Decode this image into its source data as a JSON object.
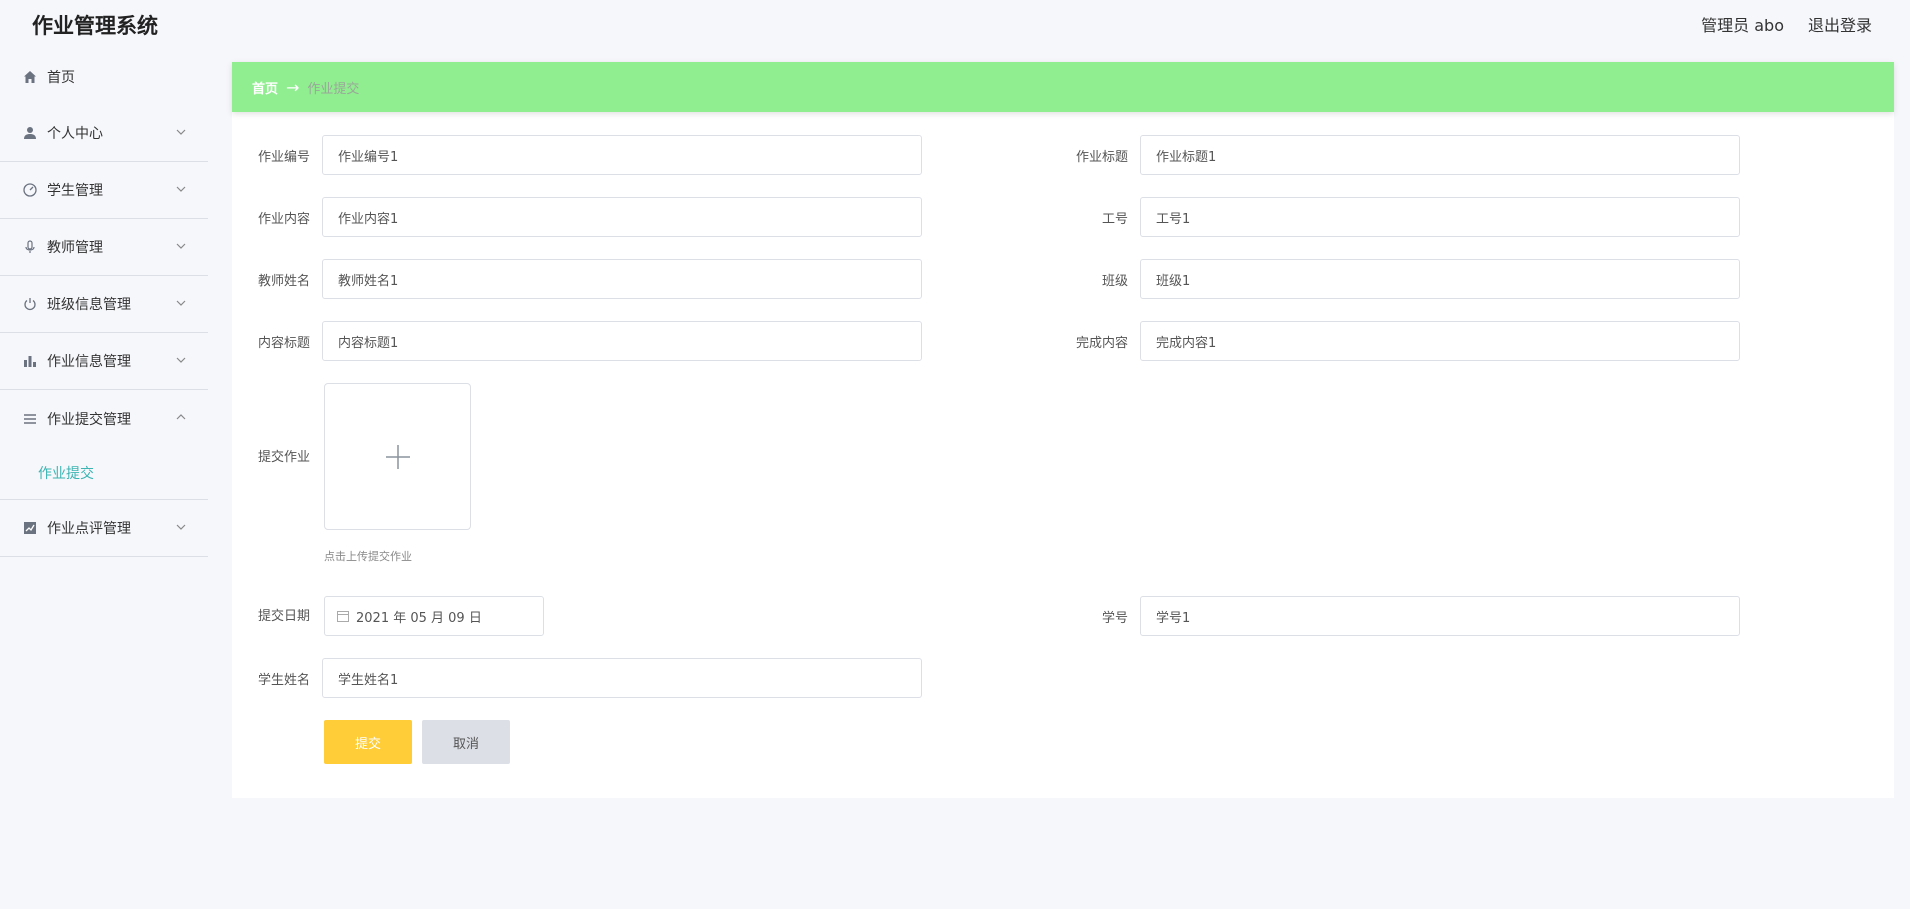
{
  "app": {
    "title": "作业管理系统"
  },
  "header": {
    "user": "管理员 abo",
    "logout": "退出登录"
  },
  "sidebar": {
    "items": [
      {
        "label": "首页",
        "icon": "home-icon"
      },
      {
        "label": "个人中心",
        "icon": "user-icon"
      },
      {
        "label": "学生管理",
        "icon": "dashboard-icon"
      },
      {
        "label": "教师管理",
        "icon": "microphone-icon"
      },
      {
        "label": "班级信息管理",
        "icon": "power-icon"
      },
      {
        "label": "作业信息管理",
        "icon": "bar-chart-icon"
      },
      {
        "label": "作业提交管理",
        "icon": "list-icon",
        "expanded": true,
        "children": [
          "作业提交"
        ]
      },
      {
        "label": "作业点评管理",
        "icon": "line-chart-icon"
      }
    ]
  },
  "breadcrumb": {
    "home": "首页",
    "separator": "→",
    "current": "作业提交"
  },
  "form": {
    "fields": {
      "zuoye_bianhao": {
        "label": "作业编号",
        "value": "作业编号1"
      },
      "zuoye_biaoti": {
        "label": "作业标题",
        "value": "作业标题1"
      },
      "zuoye_neirong": {
        "label": "作业内容",
        "value": "作业内容1"
      },
      "gonghao": {
        "label": "工号",
        "value": "工号1"
      },
      "jiaoshi_xingming": {
        "label": "教师姓名",
        "value": "教师姓名1"
      },
      "banji": {
        "label": "班级",
        "value": "班级1"
      },
      "neirong_biaoti": {
        "label": "内容标题",
        "value": "内容标题1"
      },
      "wancheng_neirong": {
        "label": "完成内容",
        "value": "完成内容1"
      },
      "xuehao": {
        "label": "学号",
        "value": "学号1"
      },
      "xuesheng_xingming": {
        "label": "学生姓名",
        "value": "学生姓名1"
      }
    },
    "upload": {
      "label": "提交作业",
      "hint": "点击上传提交作业"
    },
    "date": {
      "label": "提交日期",
      "value": "2021 年 05 月 09 日"
    },
    "buttons": {
      "submit": "提交",
      "cancel": "取消"
    }
  },
  "colors": {
    "breadcrumb_bg": "#90ee90",
    "active_menu": "#3bb4b2",
    "submit_button": "#ffcd38",
    "cancel_button": "#dcdfe6"
  }
}
